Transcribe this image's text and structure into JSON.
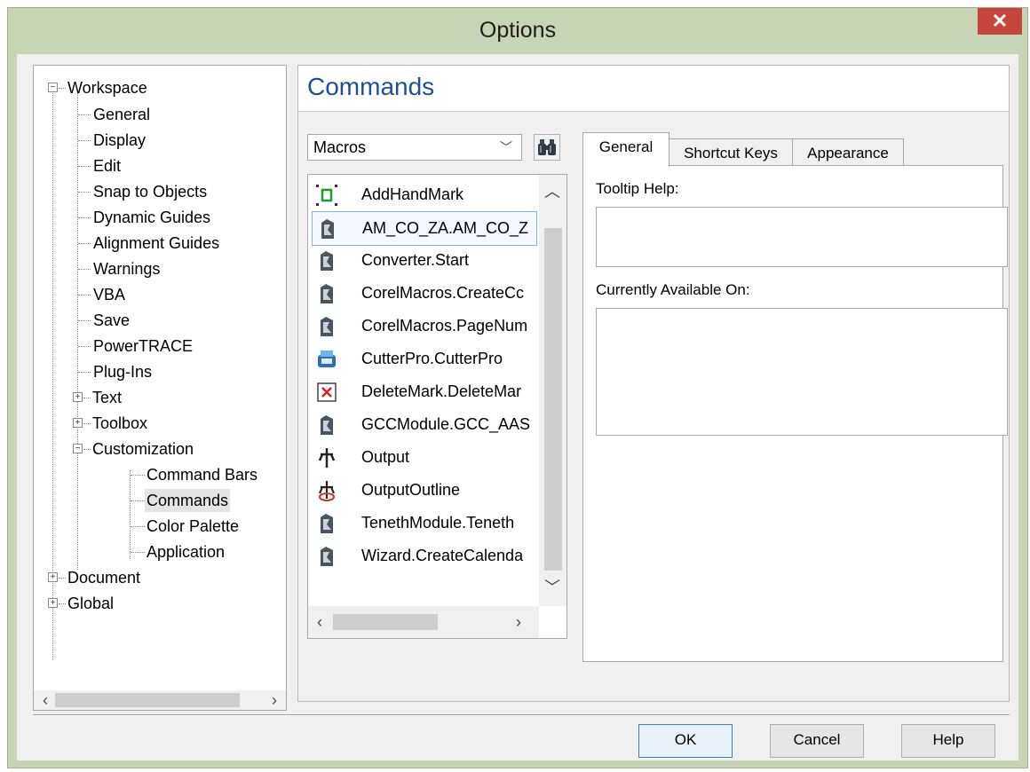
{
  "window": {
    "title": "Options",
    "close_glyph": "✕"
  },
  "tree": {
    "root_workspace": "Workspace",
    "workspace_children": [
      "General",
      "Display",
      "Edit",
      "Snap to Objects",
      "Dynamic Guides",
      "Alignment Guides",
      "Warnings",
      "VBA",
      "Save",
      "PowerTRACE",
      "Plug-Ins"
    ],
    "text": "Text",
    "toolbox": "Toolbox",
    "customization": "Customization",
    "customization_children": [
      "Command Bars",
      "Commands",
      "Color Palette",
      "Application"
    ],
    "selected": "Commands",
    "root_document": "Document",
    "root_global": "Global"
  },
  "panel": {
    "title": "Commands",
    "category_select": "Macros",
    "commands": [
      {
        "label": "AddHandMark",
        "icon": "hand-mark-icon"
      },
      {
        "label": "AM_CO_ZA.AM_CO_Z",
        "icon": "macro-icon",
        "selected": true
      },
      {
        "label": "Converter.Start",
        "icon": "macro-icon"
      },
      {
        "label": "CorelMacros.CreateCc",
        "icon": "macro-icon"
      },
      {
        "label": "CorelMacros.PageNum",
        "icon": "macro-icon"
      },
      {
        "label": "CutterPro.CutterPro",
        "icon": "cutter-icon"
      },
      {
        "label": "DeleteMark.DeleteMar",
        "icon": "delete-mark-icon"
      },
      {
        "label": "GCCModule.GCC_AAS",
        "icon": "macro-icon"
      },
      {
        "label": "Output",
        "icon": "output-icon"
      },
      {
        "label": "OutputOutline",
        "icon": "output-outline-icon"
      },
      {
        "label": "TenethModule.Teneth",
        "icon": "macro-icon"
      },
      {
        "label": "Wizard.CreateCalenda",
        "icon": "macro-icon"
      }
    ],
    "tabs": [
      "General",
      "Shortcut Keys",
      "Appearance"
    ],
    "active_tab": "General",
    "tooltip_help_label": "Tooltip Help:",
    "available_on_label": "Currently Available On:"
  },
  "buttons": {
    "ok": "OK",
    "cancel": "Cancel",
    "help": "Help"
  }
}
